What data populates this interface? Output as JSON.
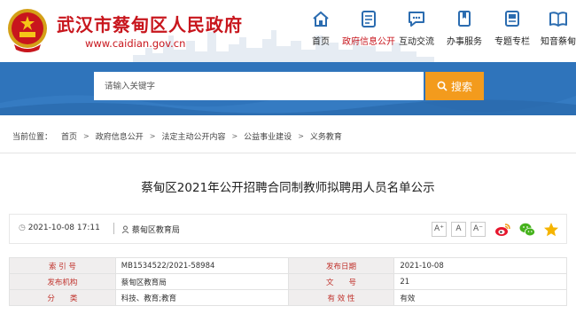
{
  "site": {
    "name": "武汉市蔡甸区人民政府",
    "url": "www.caidian.gov.cn"
  },
  "nav": [
    {
      "label": "首页",
      "icon": "home-icon"
    },
    {
      "label": "政府信息公开",
      "icon": "document-icon",
      "active": true
    },
    {
      "label": "互动交流",
      "icon": "chat-icon"
    },
    {
      "label": "办事服务",
      "icon": "bookmark-icon"
    },
    {
      "label": "专题专栏",
      "icon": "column-icon"
    },
    {
      "label": "知音蔡甸",
      "icon": "book-icon"
    }
  ],
  "search": {
    "placeholder": "请输入关键字",
    "button_label": "搜索"
  },
  "breadcrumb": {
    "prefix": "当前位置：",
    "items": [
      "首页",
      "政府信息公开",
      "法定主动公开内容",
      "公益事业建设",
      "义务教育"
    ]
  },
  "article": {
    "title": "蔡甸区2021年公开招聘合同制教师拟聘用人员名单公示",
    "date": "2021-10-08 17:11",
    "source": "蔡甸区教育局",
    "font_sizes": [
      "A⁺",
      "A",
      "A⁻"
    ]
  },
  "info_table": {
    "rows": [
      [
        "索 引 号",
        "MB1534522/2021-58984",
        "发布日期",
        "2021-10-08"
      ],
      [
        "发布机构",
        "蔡甸区教育局",
        "文　　号",
        "21"
      ],
      [
        "分　　类",
        "科技、教育;教育",
        "有 效 性",
        "有效"
      ]
    ]
  },
  "colors": {
    "brand_red": "#c8161d",
    "search_blue": "#2f74bb",
    "search_orange": "#f39b1d",
    "nav_icon_blue": "#2b6cb0"
  }
}
